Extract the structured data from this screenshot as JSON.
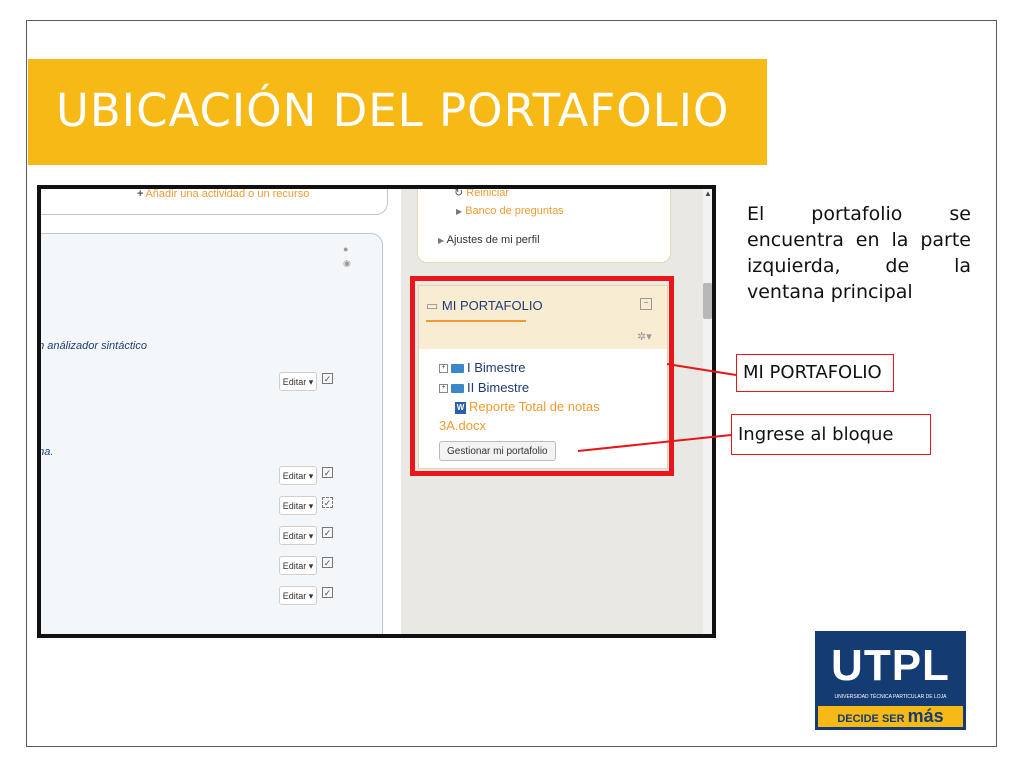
{
  "slide": {
    "title": "UBICACIÓN DEL PORTAFOLIO",
    "description": "El portafolio se encuentra en la parte izquierda, de la ventana principal",
    "callout_mi": "MI PORTAFOLIO",
    "callout_block": "Ingrese al bloque"
  },
  "screenshot": {
    "add_activity": "Añadir una actividad o un recurso",
    "analyzer_text": "un análizador  sintáctico",
    "ana_text": "ana.",
    "edit_label": "Editar",
    "top_block": {
      "reset": "Reiniciar",
      "question_bank": "Banco de preguntas",
      "profile_settings": "Ajustes de mi perfil"
    },
    "portfolio": {
      "title": "MI PORTAFOLIO",
      "items": [
        "I Bimestre",
        "II Bimestre"
      ],
      "file_line1": "Reporte Total de notas",
      "file_line2": "3A.docx",
      "manage_button": "Gestionar mi portafolio"
    }
  },
  "logo": {
    "name": "UTPL",
    "subtitle": "UNIVERSIDAD TÉCNICA PARTICULAR DE LOJA",
    "tagline_prefix": "DECIDE SER",
    "tagline_emphasis": "más"
  },
  "colors": {
    "title_bar": "#f6b915",
    "highlight": "#e8161a",
    "logo_blue": "#153b73",
    "link_orange": "#f09a33"
  }
}
